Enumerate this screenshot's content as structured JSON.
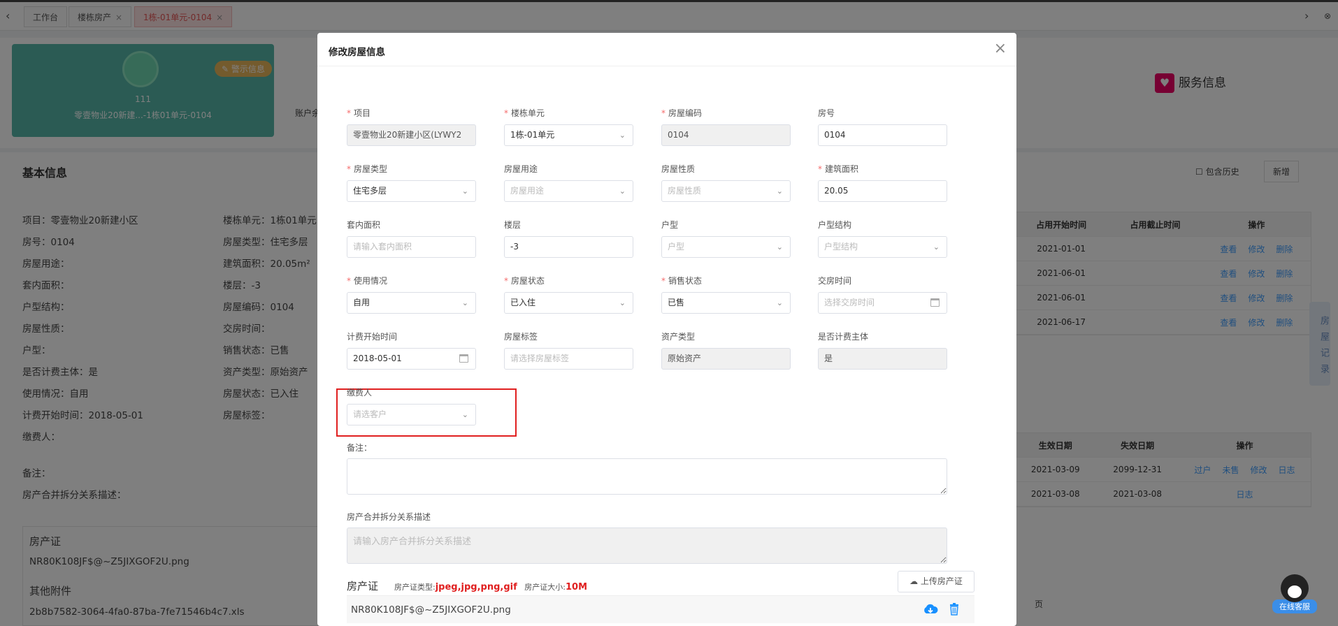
{
  "tabs": [
    {
      "label": "工作台"
    },
    {
      "label": "楼栋房产"
    },
    {
      "label": "1栋-01单元-0104"
    }
  ],
  "teal_card": {
    "badge": "警示信息",
    "number": "111",
    "address": "零壹物业20新建...-1栋01单元-0104"
  },
  "bg": {
    "account_label": "账户余",
    "service_label": "服务信息",
    "basic_title": "基本信息",
    "include_history": "包含历史",
    "add_button": "新增",
    "side_tab": "房屋记录",
    "page_label": "页",
    "info_left": [
      "项目：零壹物业20新建小区",
      "房号：0104",
      "房屋用途：",
      "套内面积：",
      "户型结构：",
      "房屋性质：",
      "户型：",
      "是否计费主体：是",
      "使用情况：自用",
      "计费开始时间：2018-05-01",
      "缴费人："
    ],
    "info_mid": [
      "楼栋单元：1栋01单元",
      "房屋类型：住宅多层",
      "建筑面积：20.05m²",
      "楼层：-3",
      "房屋编码：0104",
      "交房时间：",
      "销售状态：已售",
      "资产类型：原始资产",
      "房屋状态：已入住",
      "房屋标签："
    ],
    "remark_label": "备注：",
    "merge_label": "房产合并拆分关系描述：",
    "cert_label": "房产证",
    "cert_file": "NR80K108JF$@~Z5JIXGOF2U.png",
    "other_label": "其他附件",
    "other_file": "2b8b7582-3064-4fa0-87ba-7fe71546b4c7.xls",
    "table1": {
      "headers": [
        "占用开始时间",
        "占用截止时间",
        "操作"
      ],
      "rows": [
        "2021-01-01",
        "2021-06-01",
        "2021-06-01",
        "2021-06-17"
      ],
      "actions": [
        "查看",
        "修改",
        "删除"
      ]
    },
    "table2": {
      "headers": [
        "生效日期",
        "失效日期",
        "操作"
      ],
      "rows": [
        {
          "start": "2021-03-09",
          "end": "2099-12-31",
          "actions": [
            "过户",
            "未售",
            "修改",
            "日志"
          ]
        },
        {
          "start": "2021-03-08",
          "end": "2021-03-08",
          "actions": [
            "日志"
          ]
        }
      ]
    },
    "qq_label": "在线客服"
  },
  "modal": {
    "title": "修改房屋信息",
    "fields": {
      "project": {
        "label": "项目",
        "value": "零壹物业20新建小区(LYWY2"
      },
      "building_unit": {
        "label": "楼栋单元",
        "value": "1栋-01单元"
      },
      "house_code": {
        "label": "房屋编码",
        "value": "0104"
      },
      "house_no": {
        "label": "房号",
        "value": "0104"
      },
      "house_type": {
        "label": "房屋类型",
        "value": "住宅多层"
      },
      "house_use": {
        "label": "房屋用途",
        "placeholder": "房屋用途"
      },
      "house_nature": {
        "label": "房屋性质",
        "placeholder": "房屋性质"
      },
      "build_area": {
        "label": "建筑面积",
        "value": "20.05"
      },
      "inner_area": {
        "label": "套内面积",
        "placeholder": "请输入套内面积"
      },
      "floor": {
        "label": "楼层",
        "value": "-3"
      },
      "layout": {
        "label": "户型",
        "placeholder": "户型"
      },
      "layout_struct": {
        "label": "户型结构",
        "placeholder": "户型结构"
      },
      "usage": {
        "label": "使用情况",
        "value": "自用"
      },
      "house_status": {
        "label": "房屋状态",
        "value": "已入住"
      },
      "sale_status": {
        "label": "销售状态",
        "value": "已售"
      },
      "delivery_time": {
        "label": "交房时间",
        "placeholder": "选择交房时间"
      },
      "billing_start": {
        "label": "计费开始时间",
        "value": "2018-05-01"
      },
      "house_tag": {
        "label": "房屋标签",
        "placeholder": "请选择房屋标签"
      },
      "asset_type": {
        "label": "资产类型",
        "value": "原始资产"
      },
      "billing_subject": {
        "label": "是否计费主体",
        "value": "是"
      },
      "payer": {
        "label": "缴费人",
        "placeholder": "请选客户"
      },
      "remark": {
        "label": "备注："
      },
      "merge_desc": {
        "label": "房产合并拆分关系描述",
        "placeholder": "请输入房产合并拆分关系描述"
      }
    },
    "cert": {
      "title": "房产证",
      "type_label": "房产证类型:",
      "types": "jpeg,jpg,png,gif",
      "size_label": "房产证大小:",
      "size": "10M",
      "upload_button": "上传房产证",
      "file": "NR80K108JF$@~Z5JIXGOF2U.png"
    }
  }
}
